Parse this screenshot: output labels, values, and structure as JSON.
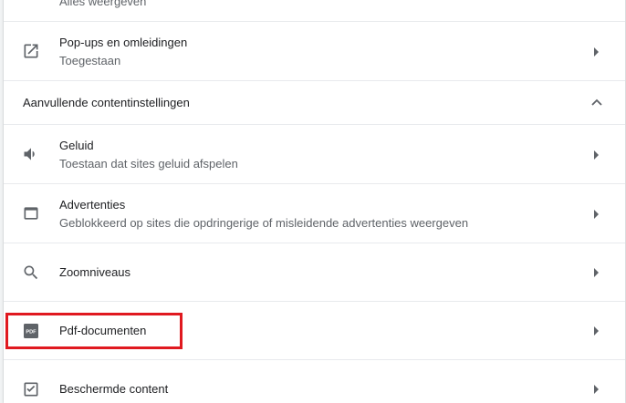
{
  "rows": [
    {
      "title": "Alles weergeven",
      "subtitle": ""
    },
    {
      "title": "Pop-ups en omleidingen",
      "subtitle": "Toegestaan",
      "icon": "open-in-new-icon"
    },
    {
      "title": "Geluid",
      "subtitle": "Toestaan dat sites geluid afspelen",
      "icon": "volume-icon"
    },
    {
      "title": "Advertenties",
      "subtitle": "Geblokkeerd op sites die opdringerige of misleidende advertenties weergeven",
      "icon": "window-icon"
    },
    {
      "title": "Zoomniveaus",
      "subtitle": "",
      "icon": "search-icon"
    },
    {
      "title": "Pdf-documenten",
      "subtitle": "",
      "icon": "pdf-icon"
    },
    {
      "title": "Beschermde content",
      "subtitle": "",
      "icon": "protected-content-icon"
    }
  ],
  "section": {
    "label": "Aanvullende contentinstellingen",
    "expanded": true
  },
  "pdf_icon_text": "PDF",
  "colors": {
    "highlight": "#e0191f",
    "icon": "#5f6368",
    "divider": "#e8eaed"
  }
}
